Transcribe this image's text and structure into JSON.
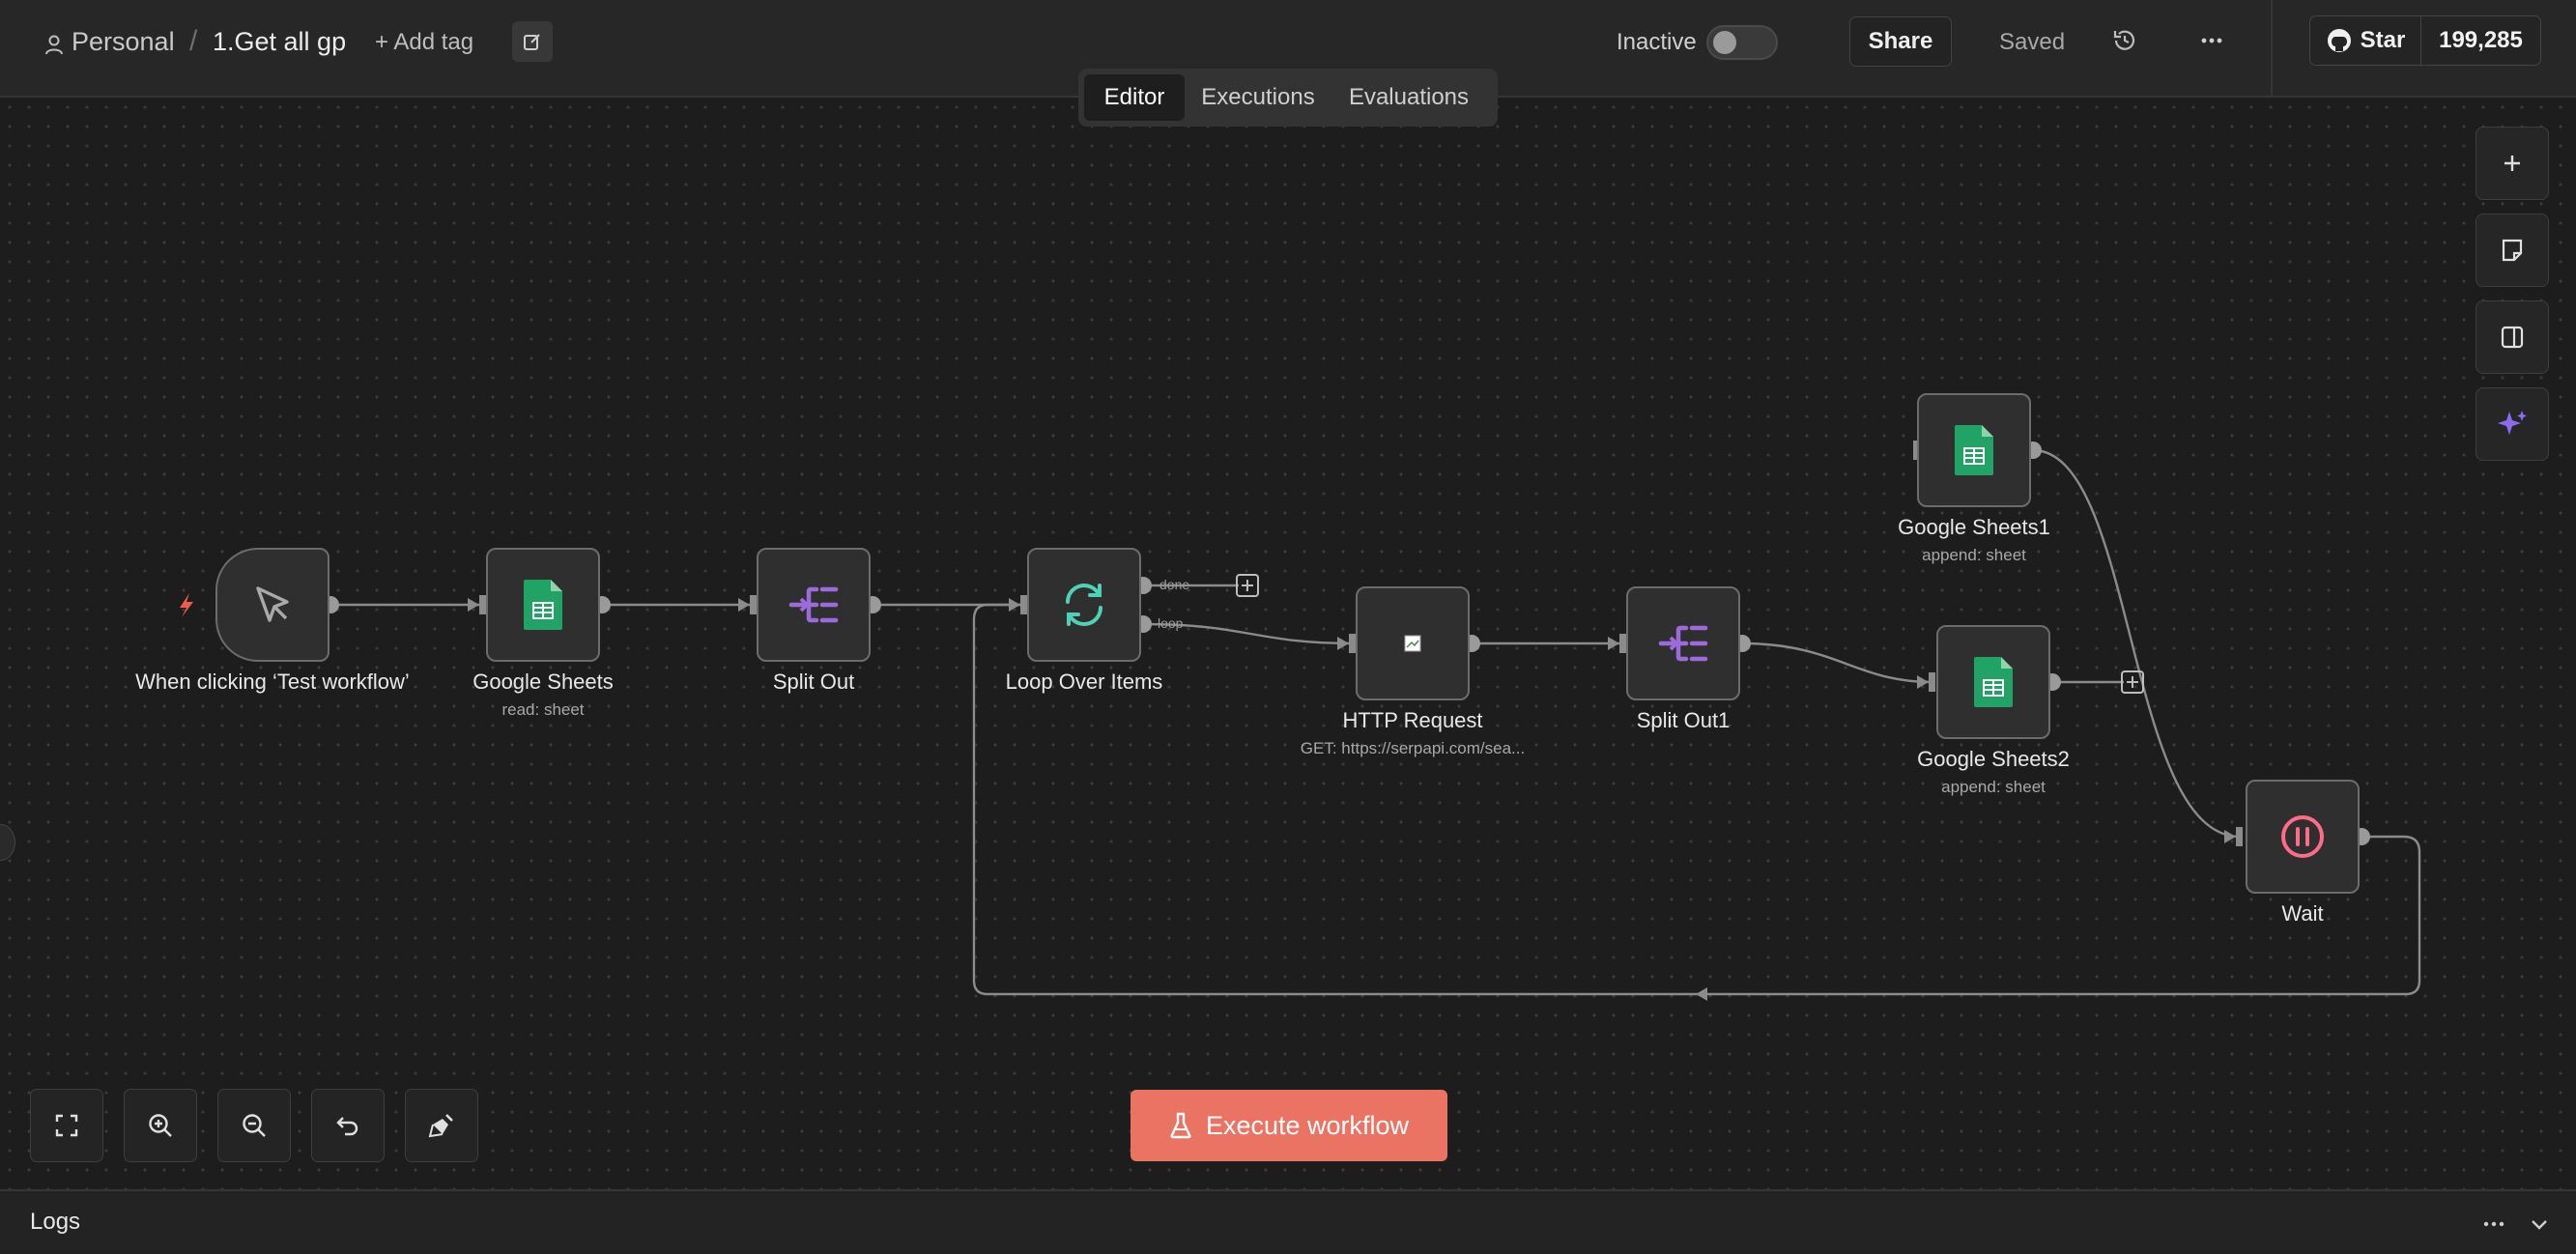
{
  "header": {
    "breadcrumb": {
      "project": "Personal",
      "separator": "/",
      "workflow_name": "1.Get all gp"
    },
    "add_tag": "+ Add tag",
    "status_label": "Inactive",
    "share_label": "Share",
    "saved_label": "Saved",
    "github": {
      "star_label": "Star",
      "star_count": "199,285"
    }
  },
  "tabs": [
    {
      "label": "Editor",
      "active": true
    },
    {
      "label": "Executions",
      "active": false
    },
    {
      "label": "Evaluations",
      "active": false
    }
  ],
  "nodes": [
    {
      "id": "trigger",
      "label": "When clicking ‘Test workflow’",
      "sublabel": "",
      "icon": "cursor-icon"
    },
    {
      "id": "sheets",
      "label": "Google Sheets",
      "sublabel": "read: sheet",
      "icon": "google-sheets-icon"
    },
    {
      "id": "split",
      "label": "Split Out",
      "sublabel": "",
      "icon": "split-out-icon"
    },
    {
      "id": "loop",
      "label": "Loop Over Items",
      "sublabel": "",
      "icon": "loop-icon"
    },
    {
      "id": "http",
      "label": "HTTP Request",
      "sublabel": "GET: https://serpapi.com/sea...",
      "icon": "broken-image-icon"
    },
    {
      "id": "split1",
      "label": "Split Out1",
      "sublabel": "",
      "icon": "split-out-icon"
    },
    {
      "id": "sheets1",
      "label": "Google Sheets1",
      "sublabel": "append: sheet",
      "icon": "google-sheets-icon"
    },
    {
      "id": "sheets2",
      "label": "Google Sheets2",
      "sublabel": "append: sheet",
      "icon": "google-sheets-icon"
    },
    {
      "id": "wait",
      "label": "Wait",
      "sublabel": "",
      "icon": "pause-icon"
    }
  ],
  "edge_labels": {
    "done": "done",
    "loop": "loop"
  },
  "execute_label": "Execute workflow",
  "logs_label": "Logs",
  "colors": {
    "accent": "#ea7363",
    "sheets_green": "#21a366",
    "split_purple": "#9b6bdc",
    "loop_teal": "#4fd1b5",
    "wait_pink": "#ff6b8b",
    "trigger_bolt": "#ef5b4c"
  }
}
